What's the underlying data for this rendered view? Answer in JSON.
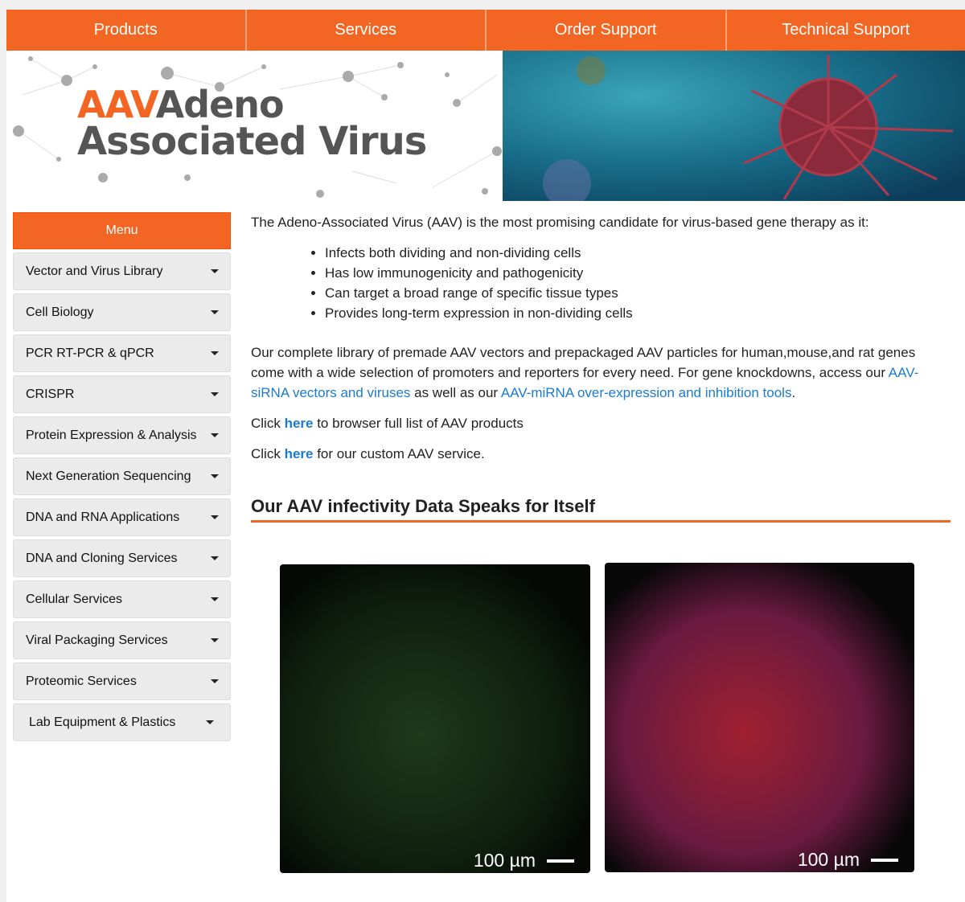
{
  "nav": [
    "Products",
    "Services",
    "Order Support",
    "Technical Support"
  ],
  "banner": {
    "aav": "AAV",
    "line1": "Adeno",
    "line2": "Associated Virus"
  },
  "sidebar": {
    "header": "Menu",
    "items": [
      "Vector and Virus Library",
      "Cell Biology",
      "PCR RT-PCR & qPCR",
      "CRISPR",
      "Protein Expression & Analysis",
      "Next Generation Sequencing",
      "DNA and RNA Applications",
      "DNA and Cloning Services",
      "Cellular Services",
      "Viral Packaging Services",
      "Proteomic Services",
      "Lab Equipment & Plastics"
    ]
  },
  "main": {
    "intro": "The Adeno-Associated Virus (AAV) is the most promising candidate for virus-based gene therapy as it:",
    "bullets": [
      "Infects both dividing and non-dividing cells",
      "Has low immunogenicity and pathogenicity",
      "Can target a broad range of specific tissue types",
      "Provides long-term expression in non-dividing cells"
    ],
    "para1": "Our complete library of premade AAV vectors and prepackaged AAV particles for human,mouse,and rat genes come with a wide selection of promoters and reporters for every need. For gene knockdowns, access our ",
    "link1": "AAV-siRNA vectors and viruses",
    "mid": " as well as our ",
    "link2": "AAV-miRNA over-expression and inhibition tools",
    "end": ".",
    "click": "Click ",
    "here": "here",
    "click1_rest": " to browser full list of AAV products",
    "click2_rest": " for our custom AAV service.",
    "heading": "Our AAV infectivity Data Speaks for Itself",
    "scale": "100 µm"
  }
}
